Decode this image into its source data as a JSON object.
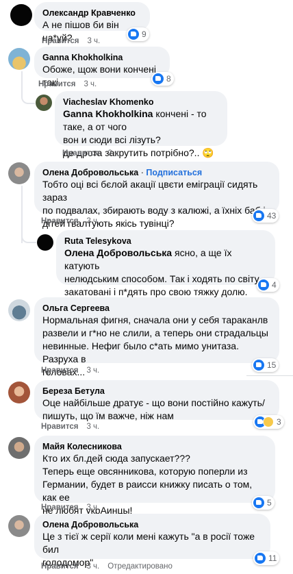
{
  "ui": {
    "like_label": "Нравится",
    "follow_label": "Подписаться",
    "dot": "·"
  },
  "comments": [
    {
      "author": "Олександр Кравченко",
      "lines": [
        "А не пішов би він на*уй?"
      ],
      "time": "3 ч.",
      "reactions": "9"
    },
    {
      "author": "Ganna Khokholkina",
      "lines": [
        "Обоже, щож вони кончені такі"
      ],
      "time": "3 ч.",
      "reactions": "8"
    },
    {
      "author": "Viacheslav Khomenko",
      "tag": "Ganna Khokholkina",
      "lines": [
        " кончені - то таке, а от чого",
        "вон и сюди всі лізуть?",
        "де дрота закрутить потрібно?.. 🙄"
      ],
      "time": "2 ч."
    },
    {
      "author": "Олена Добровольська",
      "lines": [
        "Тобто оці всі бєлой акації цвєти еміграції сидять зараз",
        "по подвалах, збирають воду з калюжі, а їхніх баб і",
        "дітей гвалтують якісь тувінці?"
      ],
      "time": "3 ч.",
      "reactions": "43"
    },
    {
      "author": "Ruta Telesykova",
      "tag": "Олена Добровольська",
      "lines": [
        " ясно, а ще їх катують",
        "нелюдським способом. Так і ходять по світу",
        "закатовані і п*дять про свою тяжку долю."
      ],
      "time": "",
      "reactions": "4"
    },
    {
      "author": "Ольга Сергеева",
      "lines": [
        "Нормальная фигня, сначала они у себя тараканлв",
        "развели и г*но не слили, а теперь они страдальцы",
        "невинные. Нефиг было с*ать мимо унитаза. Разруха в",
        "головах..."
      ],
      "time": "3 ч.",
      "reactions": "15"
    },
    {
      "author": "Береза Бетула",
      "lines": [
        "Оце найбільше дратує - що вони постійно кажуть/",
        "пишуть, що їм важче, ніж нам"
      ],
      "time": "3 ч.",
      "reactions": "3"
    },
    {
      "author": "Майя Колесникова",
      "lines": [
        "Кто их бл.дей сюда запускает???",
        "Теперь еще овсянникова, которую поперли из",
        "Германии, будет в раисси книжку писать о том, как ее",
        "не любят укрАинцы!"
      ],
      "time": "3 ч.",
      "reactions": "5"
    },
    {
      "author": "Олена Добровольська",
      "lines": [
        "Це з тієї ж серії коли мені кажуть \"а в росії тоже бил",
        "голодомор\""
      ],
      "time": "3 ч.",
      "edited": "Отредактировано",
      "reactions": "11"
    }
  ]
}
